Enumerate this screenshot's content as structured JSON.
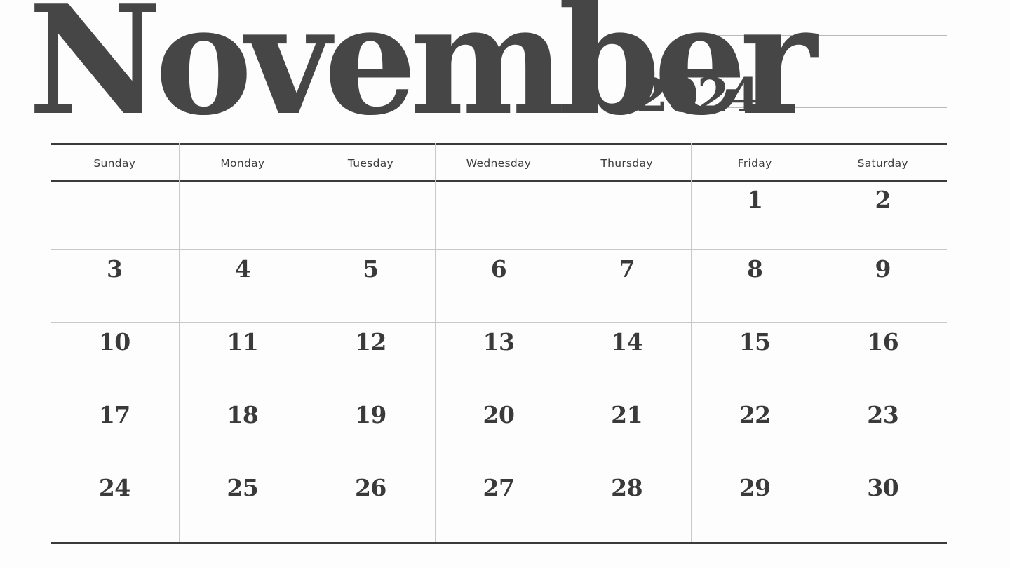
{
  "document": {
    "type": "printable-monthly-calendar",
    "month": "November",
    "year": "2024"
  },
  "colors": {
    "ink": "#464646",
    "date_ink": "#3a3a3a",
    "rule_strong": "#3b3b3b",
    "rule_light": "#c9c9c9",
    "note_line": "#b9b9bb",
    "page_background": "#fdfdfd"
  },
  "notes": {
    "lines": [
      "",
      "",
      ""
    ]
  },
  "calendar": {
    "weekday_headers": [
      "Sunday",
      "Monday",
      "Tuesday",
      "Wednesday",
      "Thursday",
      "Friday",
      "Saturday"
    ],
    "weeks": [
      [
        "",
        "",
        "",
        "",
        "",
        "1",
        "2"
      ],
      [
        "3",
        "4",
        "5",
        "6",
        "7",
        "8",
        "9"
      ],
      [
        "10",
        "11",
        "12",
        "13",
        "14",
        "15",
        "16"
      ],
      [
        "17",
        "18",
        "19",
        "20",
        "21",
        "22",
        "23"
      ],
      [
        "24",
        "25",
        "26",
        "27",
        "28",
        "29",
        "30"
      ]
    ]
  }
}
